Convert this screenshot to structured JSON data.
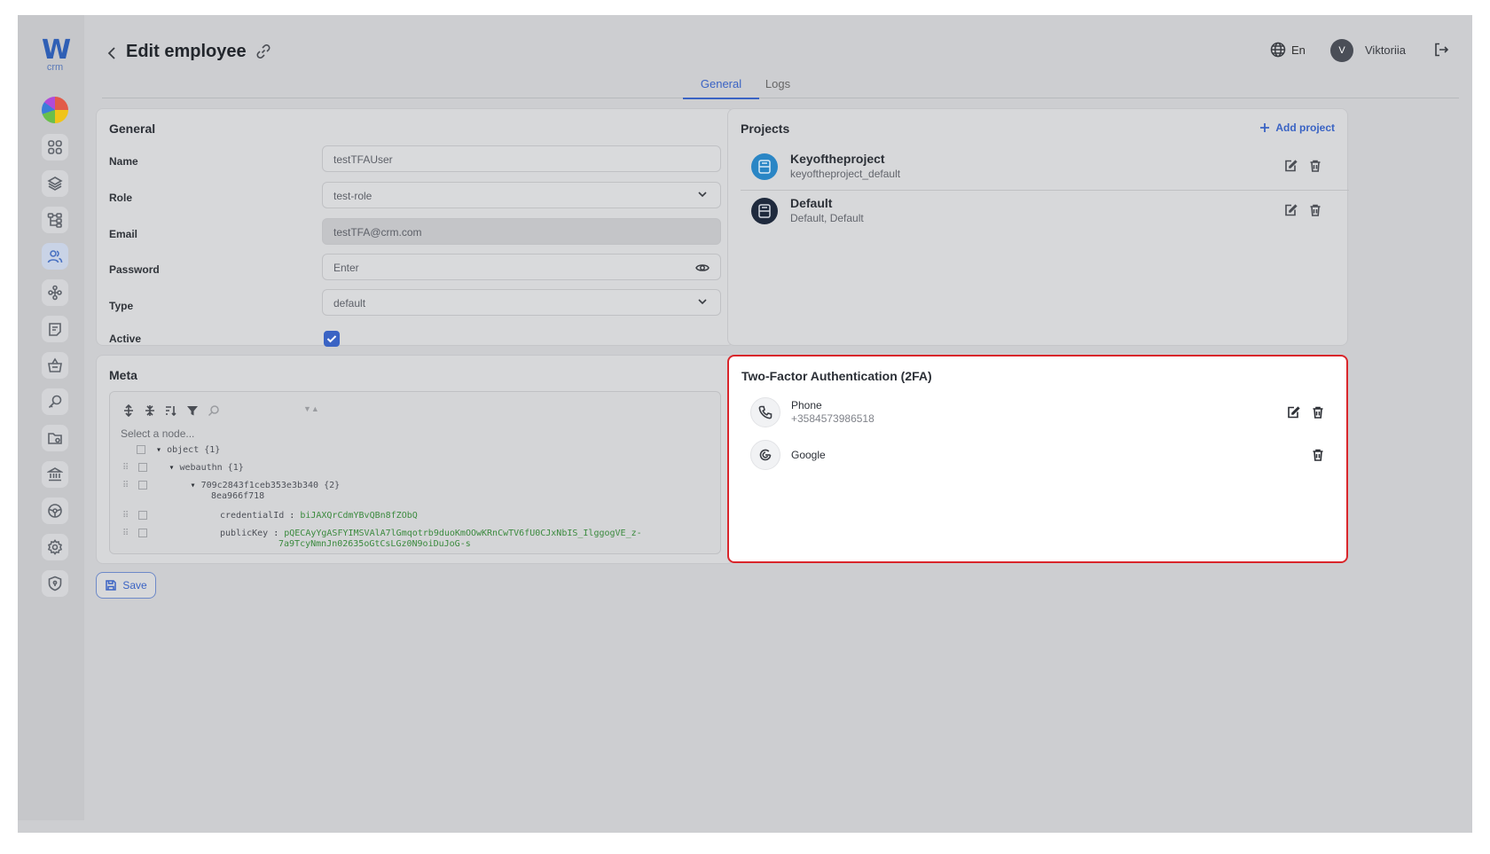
{
  "brand": {
    "logo_letter": "W",
    "logo_sub": "crm"
  },
  "sidebar": {
    "items": [
      {
        "icon": "grid-icon"
      },
      {
        "icon": "layers-icon"
      },
      {
        "icon": "hierarchy-icon"
      },
      {
        "icon": "users-icon",
        "active": true
      },
      {
        "icon": "org-chart-icon"
      },
      {
        "icon": "notes-icon"
      },
      {
        "icon": "basket-icon"
      },
      {
        "icon": "key-icon"
      },
      {
        "icon": "folder-icon"
      },
      {
        "icon": "bank-icon"
      },
      {
        "icon": "steering-wheel-icon"
      },
      {
        "icon": "settings-icon"
      },
      {
        "icon": "shield-icon"
      }
    ]
  },
  "header": {
    "title": "Edit employee",
    "language": "En",
    "avatar_initial": "V",
    "username": "Viktoriia"
  },
  "tabs": [
    {
      "label": "General",
      "active": true
    },
    {
      "label": "Logs",
      "active": false
    }
  ],
  "general": {
    "title": "General",
    "fields": {
      "name": {
        "label": "Name",
        "value": "testTFAUser"
      },
      "role": {
        "label": "Role",
        "value": "test-role"
      },
      "email": {
        "label": "Email",
        "value": "testTFA@crm.com"
      },
      "password": {
        "label": "Password",
        "placeholder": "Enter"
      },
      "type": {
        "label": "Type",
        "value": "default"
      },
      "active": {
        "label": "Active",
        "checked": true
      }
    }
  },
  "meta": {
    "title": "Meta",
    "select_hint": "Select a node...",
    "tree": {
      "root": "object {1}",
      "webauthn": "webauthn {1}",
      "cred_node": "709c2843f1ceb353e3b340 {2}",
      "cred_node_cont": "8ea966f718",
      "credentialId_key": "credentialId",
      "credentialId_val": "biJAXQrCdmYBvQBn8fZObQ",
      "publicKey_key": "publicKey",
      "publicKey_val": "pQECAyYgASFYIMSVAlA7lGmqotrb9duoKmOOwKRnCwTV6fU0CJxNbIS_IlggogVE_z-",
      "publicKey_val_cont": "7a9TcyNmnJn02635oGtCsLGz0N9oiDuJoG-s"
    }
  },
  "projects": {
    "title": "Projects",
    "add_label": "Add project",
    "items": [
      {
        "name": "Keyoftheproject",
        "sub": "keyoftheproject_default",
        "color": "#2a86c5"
      },
      {
        "name": "Default",
        "sub": "Default, Default",
        "color": "#1f2a3d"
      }
    ]
  },
  "tfa": {
    "title": "Two-Factor Authentication (2FA)",
    "methods": [
      {
        "name": "Phone",
        "detail": "+3584573986518",
        "icon": "phone-icon"
      },
      {
        "name": "Google",
        "icon": "google-icon"
      }
    ]
  },
  "actions": {
    "save_label": "Save"
  },
  "colors": {
    "accent": "#3a63c4",
    "highlight_border": "#d9262b"
  }
}
